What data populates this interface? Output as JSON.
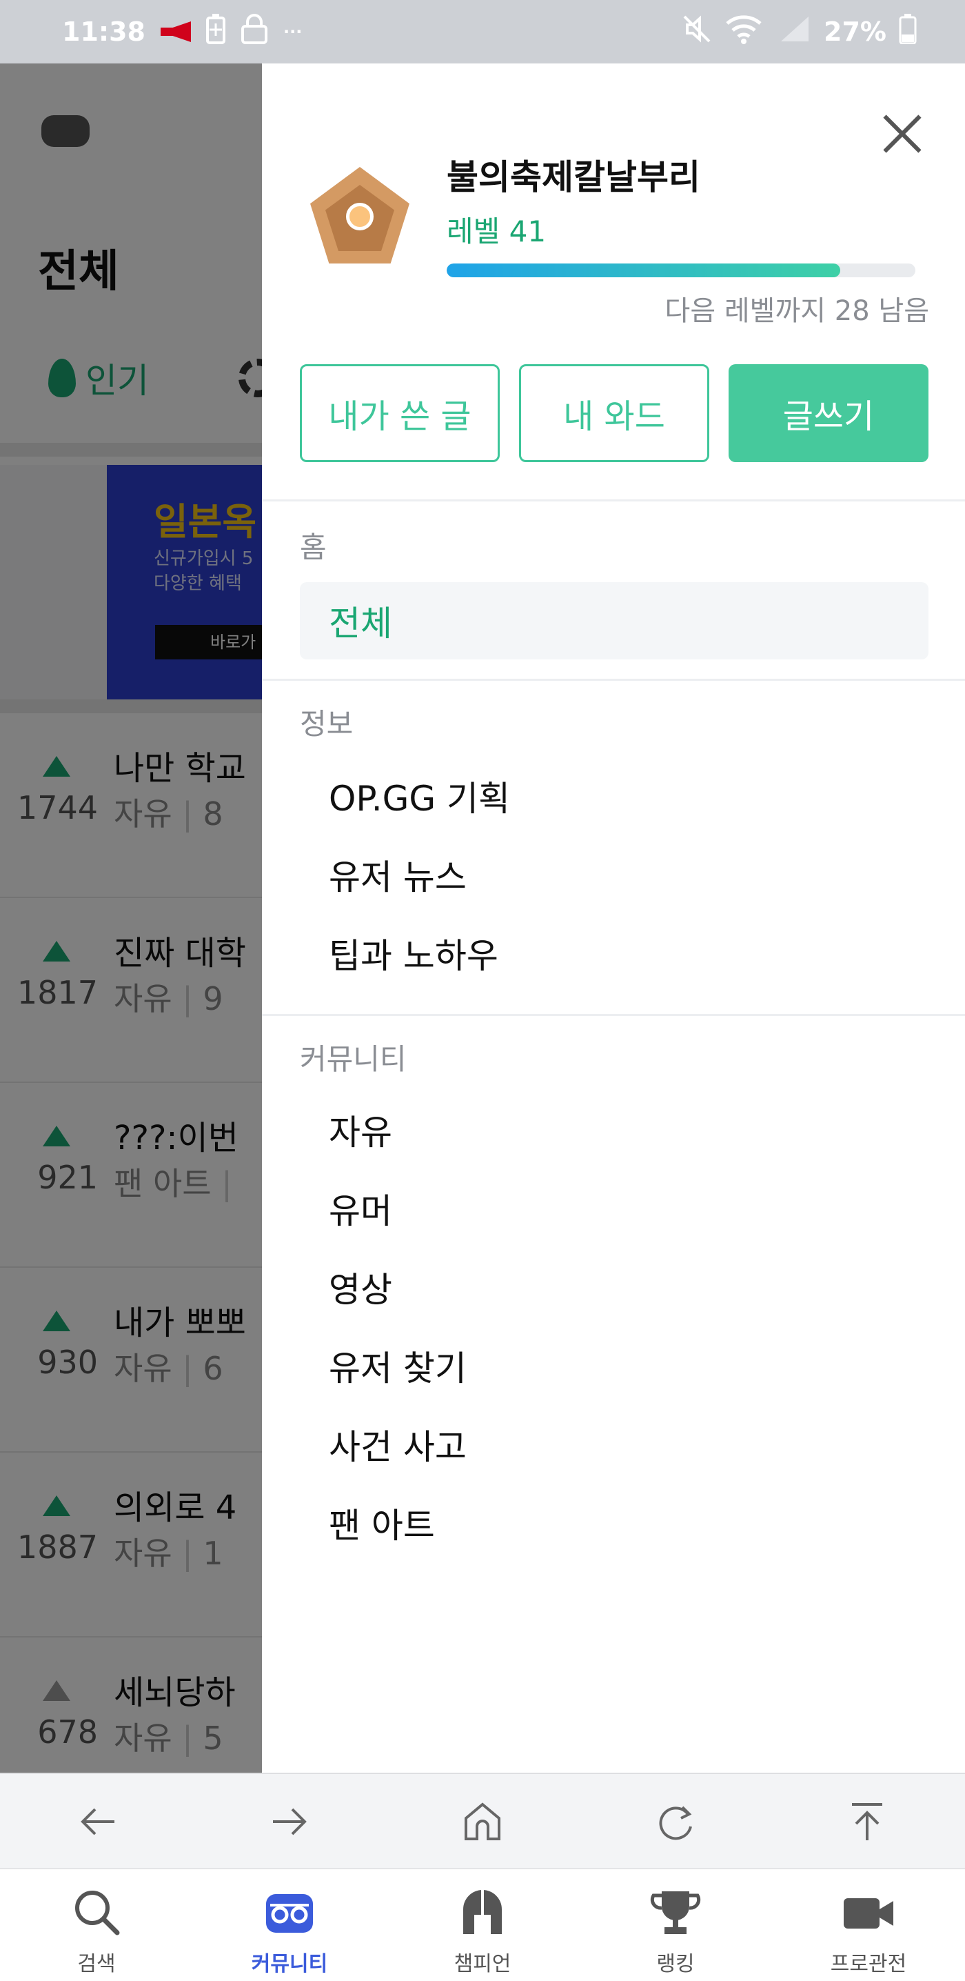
{
  "status_bar": {
    "time": "11:38",
    "dots": "···",
    "battery": "27%"
  },
  "background_page": {
    "title": "전체",
    "tab_hot": "인기",
    "banner": {
      "title": "일본옥",
      "sub1": "신규가입시 5",
      "sub2": "다양한 혜택",
      "button": "바로가"
    },
    "posts": [
      {
        "title": "나만 학교",
        "count": "1744",
        "category": "자유",
        "extra": "8",
        "arrow": "up-green"
      },
      {
        "title": "진짜 대학",
        "count": "1817",
        "category": "자유",
        "extra": "9",
        "arrow": "up-green"
      },
      {
        "title": "???:이번",
        "count": "921",
        "category": "팬 아트",
        "extra": "",
        "arrow": "up-green"
      },
      {
        "title": "내가 뽀뽀",
        "count": "930",
        "category": "자유",
        "extra": "6",
        "arrow": "up-green"
      },
      {
        "title": "의외로 4",
        "count": "1887",
        "category": "자유",
        "extra": "1",
        "arrow": "up-green"
      },
      {
        "title": "세뇌당하",
        "count": "678",
        "category": "자유",
        "extra": "5",
        "arrow": "up-grey"
      }
    ]
  },
  "drawer": {
    "username": "불의축제칼날부리",
    "level": "레벨 41",
    "level_progress": 0.84,
    "next_level_text": "다음 레벨까지 28 남음",
    "buttons": {
      "my_posts": "내가 쓴 글",
      "my_ward": "내 와드",
      "write": "글쓰기"
    },
    "sections": [
      {
        "label": "홈",
        "items": [
          {
            "label": "전체",
            "active": true
          }
        ]
      },
      {
        "label": "정보",
        "items": [
          {
            "label": "OP.GG 기획"
          },
          {
            "label": "유저 뉴스"
          },
          {
            "label": "팁과 노하우"
          }
        ]
      },
      {
        "label": "커뮤니티",
        "items": [
          {
            "label": "자유"
          },
          {
            "label": "유머"
          },
          {
            "label": "영상"
          },
          {
            "label": "유저 찾기"
          },
          {
            "label": "사건 사고"
          },
          {
            "label": "팬 아트"
          }
        ]
      }
    ]
  },
  "browser_nav": [
    "back-icon",
    "forward-icon",
    "home-icon",
    "refresh-icon",
    "scroll-top-icon"
  ],
  "tabs": [
    {
      "label": "검색",
      "icon": "search-icon"
    },
    {
      "label": "커뮤니티",
      "icon": "community-icon",
      "active": true
    },
    {
      "label": "챔피언",
      "icon": "champion-helmet-icon"
    },
    {
      "label": "랭킹",
      "icon": "trophy-icon"
    },
    {
      "label": "프로관전",
      "icon": "video-camera-icon"
    }
  ],
  "colors": {
    "accent_green": "#1aa672",
    "button_green": "#46c99c",
    "active_tab_blue": "#3b5bdb",
    "status_bar": "#cdd0d5"
  }
}
